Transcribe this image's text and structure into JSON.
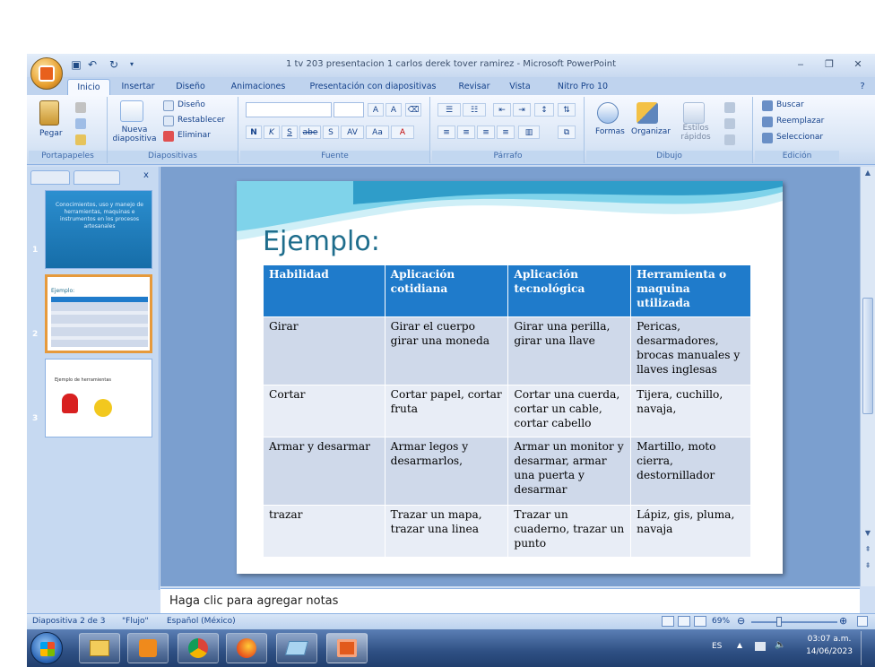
{
  "window": {
    "title": "1 tv 203 presentacion 1 carlos derek tover ramirez - Microsoft PowerPoint",
    "minimize": "‒",
    "restore": "❐",
    "close": "✕"
  },
  "tabs": [
    "Inicio",
    "Insertar",
    "Diseño",
    "Animaciones",
    "Presentación con diapositivas",
    "Revisar",
    "Vista",
    "Nitro Pro 10"
  ],
  "ribbon": {
    "portapapeles": {
      "pegar": "Pegar",
      "label": "Portapapeles"
    },
    "diapositivas": {
      "nueva": "Nueva diapositiva",
      "diseno": "Diseño",
      "restablecer": "Restablecer",
      "eliminar": "Eliminar",
      "label": "Diapositivas"
    },
    "fuente": {
      "label": "Fuente",
      "font_buttons": [
        "N",
        "K",
        "S",
        "abe",
        "S",
        "AV",
        "Aa",
        "A"
      ],
      "grow": "A",
      "shrink": "A"
    },
    "parrafo": {
      "label": "Párrafo"
    },
    "dibujo": {
      "formas": "Formas",
      "organizar": "Organizar",
      "estilos": "Estilos rápidos",
      "label": "Dibujo"
    },
    "edicion": {
      "buscar": "Buscar",
      "reemplazar": "Reemplazar",
      "seleccionar": "Seleccionar",
      "label": "Edición"
    }
  },
  "slides_panel": {
    "thumbs": [
      {
        "num": "1",
        "title": "Conocimientos, uso y manejo de herramientas, maquinas e instrumentos en los procesos artesanales"
      },
      {
        "num": "2",
        "title": "Ejemplo:"
      },
      {
        "num": "3",
        "title": "Ejemplo de herramientas"
      }
    ]
  },
  "slide": {
    "title": "Ejemplo:",
    "headers": [
      "Habilidad",
      "Aplicación cotidiana",
      "Aplicación tecnológica",
      "Herramienta o maquina utilizada"
    ],
    "rows": [
      [
        "Girar",
        "Girar el cuerpo girar una moneda",
        "Girar una perilla, girar una llave",
        "Pericas, desarmadores, brocas manuales y llaves inglesas"
      ],
      [
        "Cortar",
        "Cortar papel, cortar fruta",
        "Cortar una cuerda, cortar un cable, cortar cabello",
        "Tijera, cuchillo, navaja,"
      ],
      [
        "Armar y desarmar",
        "Armar legos y desarmarlos,",
        "Armar un monitor y desarmar, armar una puerta y desarmar",
        "Martillo, moto cierra, destornillador"
      ],
      [
        "trazar",
        "Trazar un mapa, trazar una linea",
        "Trazar un cuaderno, trazar un punto",
        "Lápiz, gis, pluma, navaja"
      ]
    ]
  },
  "notes": {
    "placeholder": "Haga clic para agregar notas"
  },
  "status": {
    "slide": "Diapositiva 2 de 3",
    "theme": "\"Flujo\"",
    "language": "Español (México)",
    "zoom": "69%"
  },
  "taskbar": {
    "lang": "ES",
    "time": "03:07 a.m.",
    "date": "14/06/2023"
  },
  "colors": {
    "header_fill": "#1f7bcb",
    "row_odd": "#cfd9ea",
    "row_even": "#e8edf6",
    "title_color": "#1e6d8c"
  }
}
